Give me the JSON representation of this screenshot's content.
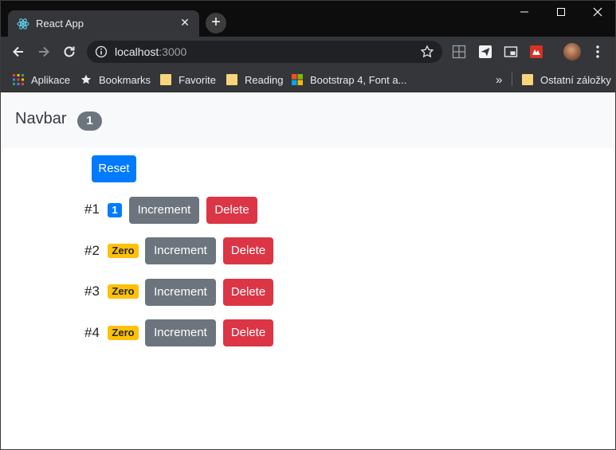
{
  "browser": {
    "tab_title": "React App",
    "url_host": "localhost",
    "url_port": ":3000",
    "bookmarks": [
      {
        "label": "Aplikace",
        "icon": "apps-grid-icon"
      },
      {
        "label": "Bookmarks",
        "icon": "star-icon"
      },
      {
        "label": "Favorite",
        "icon": "folder-icon"
      },
      {
        "label": "Reading",
        "icon": "folder-icon"
      },
      {
        "label": "Bootstrap 4, Font a...",
        "icon": "windows-logo-icon"
      }
    ],
    "overflow_label": "»",
    "other_bookmarks": "Ostatní záložky"
  },
  "navbar": {
    "brand": "Navbar",
    "total_count": "1"
  },
  "reset_label": "Reset",
  "counters": [
    {
      "label": "#1",
      "badge": "1",
      "badge_type": "primary",
      "increment_label": "Increment",
      "delete_label": "Delete"
    },
    {
      "label": "#2",
      "badge": "Zero",
      "badge_type": "warning",
      "increment_label": "Increment",
      "delete_label": "Delete"
    },
    {
      "label": "#3",
      "badge": "Zero",
      "badge_type": "warning",
      "increment_label": "Increment",
      "delete_label": "Delete"
    },
    {
      "label": "#4",
      "badge": "Zero",
      "badge_type": "warning",
      "increment_label": "Increment",
      "delete_label": "Delete"
    }
  ],
  "colors": {
    "primary": "#007bff",
    "secondary": "#6c757d",
    "danger": "#dc3545",
    "warning": "#ffc107"
  }
}
